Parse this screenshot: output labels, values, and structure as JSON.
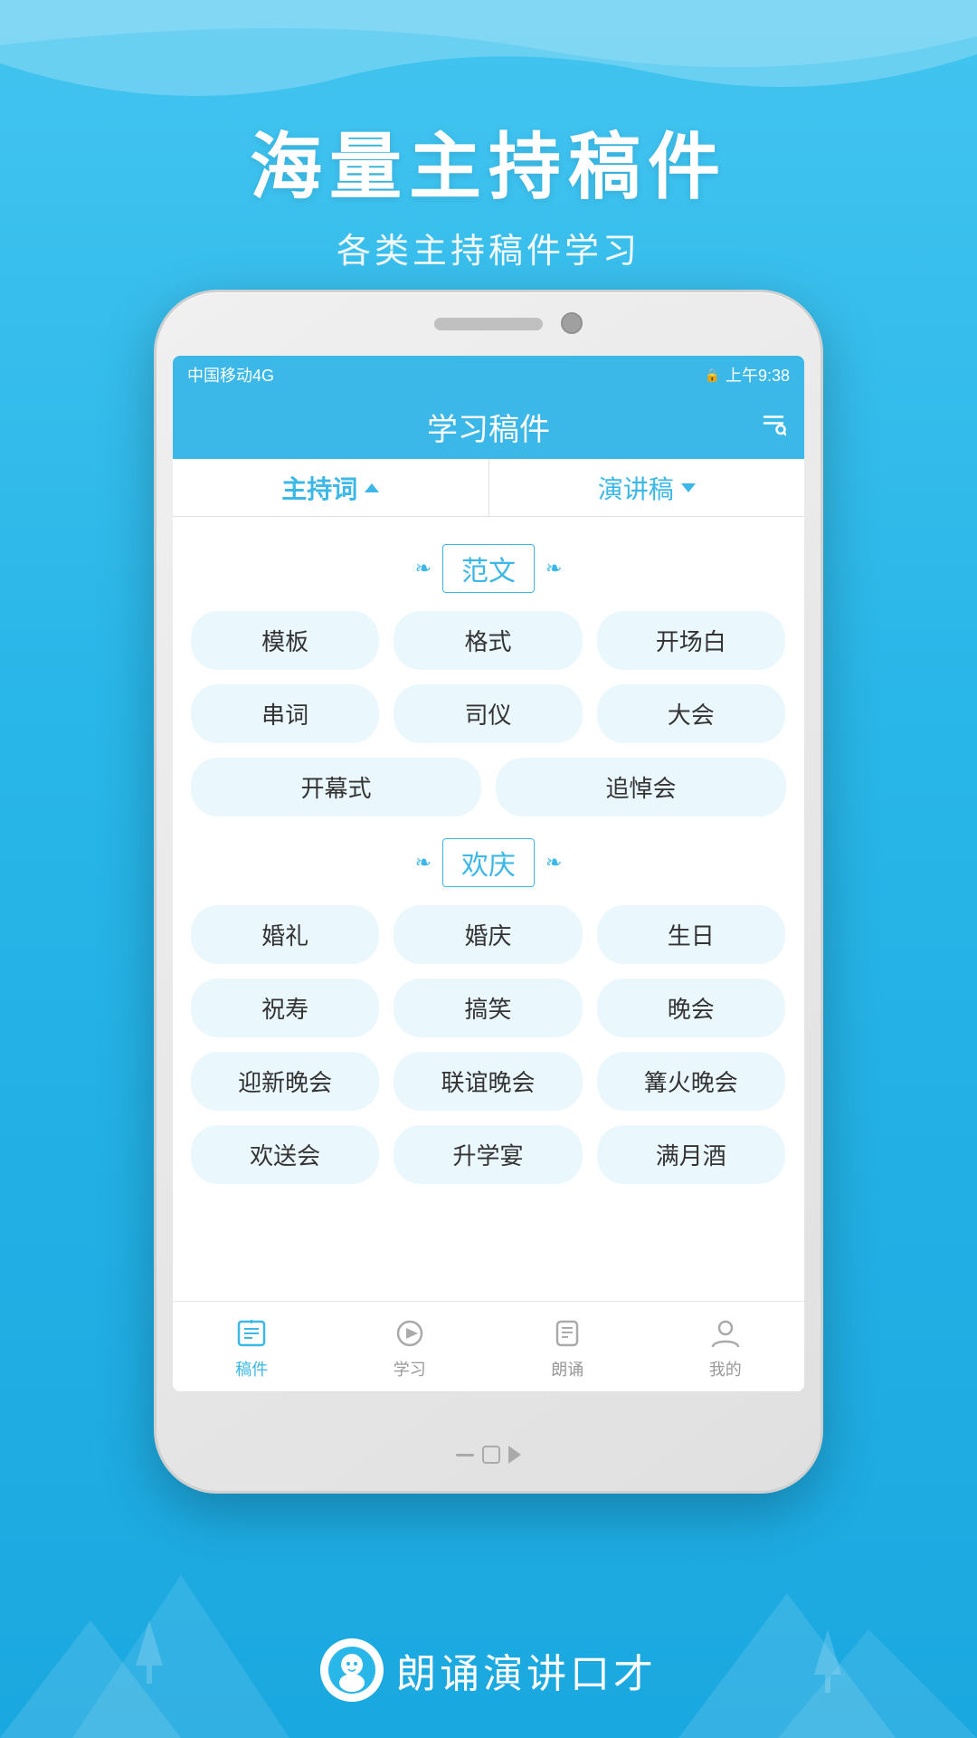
{
  "background": {
    "color": "#29b6e8"
  },
  "header": {
    "main_title": "海量主持稿件",
    "sub_title": "各类主持稿件学习"
  },
  "status_bar": {
    "carrier": "中国移动4G",
    "time": "上午9:38",
    "signal": "信号"
  },
  "app_bar": {
    "title": "学习稿件",
    "search_icon": "search-icon"
  },
  "tabs": [
    {
      "label": "主持词",
      "active": true,
      "arrow": "up"
    },
    {
      "label": "演讲稿",
      "active": false,
      "arrow": "down"
    }
  ],
  "sections": [
    {
      "title": "范文",
      "tags": [
        {
          "label": "模板"
        },
        {
          "label": "格式"
        },
        {
          "label": "开场白"
        },
        {
          "label": "串词"
        },
        {
          "label": "司仪"
        },
        {
          "label": "大会"
        },
        {
          "label": "开幕式",
          "width": "2col"
        },
        {
          "label": "追悼会",
          "width": "2col"
        }
      ]
    },
    {
      "title": "欢庆",
      "tags": [
        {
          "label": "婚礼"
        },
        {
          "label": "婚庆"
        },
        {
          "label": "生日"
        },
        {
          "label": "祝寿"
        },
        {
          "label": "搞笑"
        },
        {
          "label": "晚会"
        },
        {
          "label": "迎新晚会"
        },
        {
          "label": "联谊晚会"
        },
        {
          "label": "篝火晚会"
        },
        {
          "label": "欢送会"
        },
        {
          "label": "升学宴"
        },
        {
          "label": "满月酒"
        }
      ]
    }
  ],
  "bottom_nav": [
    {
      "label": "稿件",
      "active": true,
      "icon": "book-icon"
    },
    {
      "label": "学习",
      "active": false,
      "icon": "learn-icon"
    },
    {
      "label": "朗诵",
      "active": false,
      "icon": "recite-icon"
    },
    {
      "label": "我的",
      "active": false,
      "icon": "user-icon"
    }
  ],
  "branding": {
    "text": "朗诵演讲口才"
  }
}
